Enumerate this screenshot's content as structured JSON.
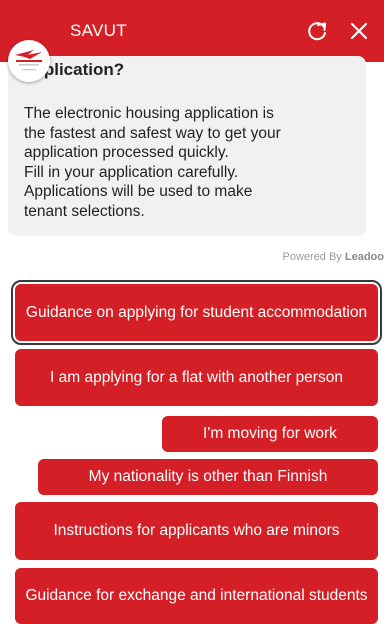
{
  "header": {
    "title": "SAVUT",
    "refresh_icon": "refresh-icon",
    "close_icon": "close-icon",
    "color": "#d41f27"
  },
  "message": {
    "heading": "application?",
    "body": "The electronic housing application is\nthe fastest and safest way to get your\napplication processed quickly.\nFill in your application carefully.\nApplications will be used to make\ntenant selections."
  },
  "powered_by": {
    "prefix": "Powered By",
    "brand": "Leadoo"
  },
  "options": [
    {
      "label": "Guidance on applying for student accommodation",
      "selected": true
    },
    {
      "label": "I am applying for a flat with another person",
      "selected": false
    },
    {
      "label": "I'm moving for work",
      "selected": false
    },
    {
      "label": "My nationality is other than Finnish",
      "selected": false
    },
    {
      "label": "Instructions for applicants who are minors",
      "selected": false
    },
    {
      "label": "Guidance for exchange and international students",
      "selected": false
    }
  ]
}
